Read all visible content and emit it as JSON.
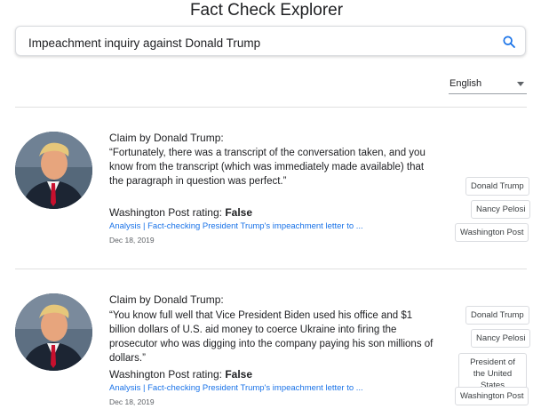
{
  "app": {
    "title": "Fact Check Explorer"
  },
  "search": {
    "value": "Impeachment inquiry against Donald Trump"
  },
  "language": {
    "selected": "English"
  },
  "claims": [
    {
      "heading": "Claim by Donald Trump:",
      "text": "“Fortunately, there was a transcript of the conversation taken, and you know from the transcript (which was immediately made available) that the paragraph in question was perfect.”",
      "publisher": "Washington Post",
      "rating_label": " rating: ",
      "rating": "False",
      "link": "Analysis | Fact-checking President Trump's impeachment letter to ...",
      "date": "Dec 18, 2019",
      "tags": [
        "Donald Trump",
        "Nancy Pelosi",
        "Washington Post"
      ]
    },
    {
      "heading": "Claim by Donald Trump:",
      "text": "“You know full well that Vice President Biden used his office and $1 billion dollars of U.S. aid money to coerce Ukraine into firing the prosecutor who was digging into the company paying his son millions of dollars.”",
      "publisher": "Washington Post",
      "rating_label": " rating: ",
      "rating": "False",
      "link": "Analysis | Fact-checking President Trump's impeachment letter to ...",
      "date": "Dec 18, 2019",
      "tags": [
        "Donald Trump",
        "Nancy Pelosi",
        "President of the United States",
        "Washington Post"
      ]
    }
  ]
}
